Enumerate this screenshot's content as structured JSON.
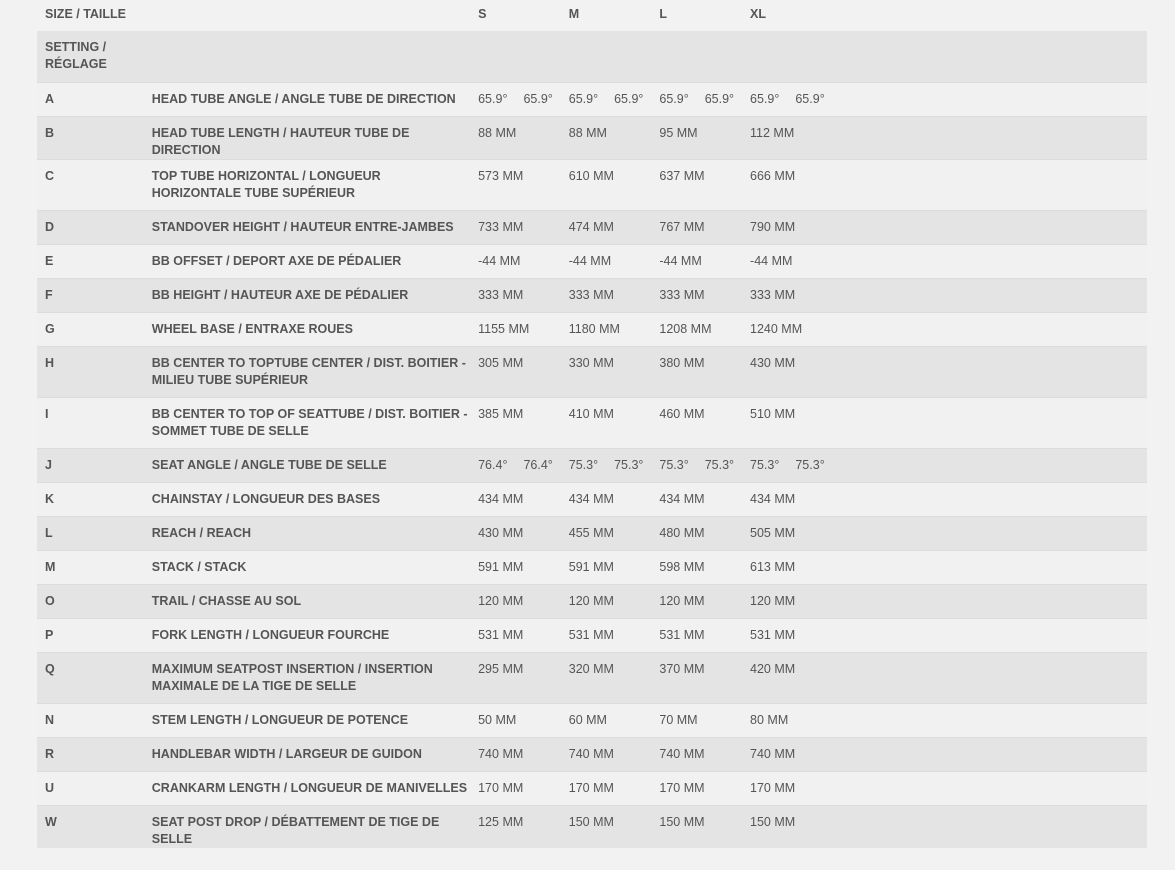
{
  "header": {
    "size_label": "SIZE / TAILLE",
    "sizes": [
      "S",
      "M",
      "L",
      "XL"
    ]
  },
  "setting_label": "SETTING /\nRÉGLAGE",
  "rows": [
    {
      "code": "A",
      "name": "HEAD TUBE ANGLE / ANGLE TUBE DE DIRECTION",
      "values": [
        "65.9°",
        "65.9°",
        "65.9°",
        "65.9°"
      ],
      "alt_values": [
        "65.9°",
        "65.9°",
        "65.9°",
        "65.9°"
      ]
    },
    {
      "code": "B",
      "name": "HEAD TUBE LENGTH / HAUTEUR TUBE DE DIRECTION",
      "values": [
        "88 MM",
        "88 MM",
        "95 MM",
        "112 MM"
      ]
    },
    {
      "code": "C",
      "name": "TOP TUBE HORIZONTAL / LONGUEUR HORIZONTALE TUBE SUPÉRIEUR",
      "values": [
        "573 MM",
        "610 MM",
        "637 MM",
        "666 MM"
      ]
    },
    {
      "code": "D",
      "name": "STANDOVER HEIGHT / HAUTEUR ENTRE-JAMBES",
      "values": [
        "733 MM",
        "474 MM",
        "767 MM",
        "790 MM"
      ]
    },
    {
      "code": "E",
      "name": "BB OFFSET / DEPORT AXE DE PÉDALIER",
      "values": [
        "-44 MM",
        "-44 MM",
        "-44 MM",
        "-44 MM"
      ]
    },
    {
      "code": "F",
      "name": "BB HEIGHT / HAUTEUR AXE DE PÉDALIER",
      "values": [
        "333 MM",
        "333 MM",
        "333 MM",
        "333 MM"
      ]
    },
    {
      "code": "G",
      "name": "WHEEL BASE / ENTRAXE ROUES",
      "values": [
        "1155 MM",
        "1180 MM",
        "1208 MM",
        "1240 MM"
      ]
    },
    {
      "code": "H",
      "name": "BB CENTER TO TOPTUBE CENTER / DIST. BOITIER - MILIEU TUBE SUPÉRIEUR",
      "values": [
        "305 MM",
        "330 MM",
        "380 MM",
        "430 MM"
      ]
    },
    {
      "code": "I",
      "name": "BB CENTER TO TOP OF SEATTUBE / DIST. BOITIER - SOMMET TUBE DE SELLE",
      "values": [
        "385 MM",
        "410 MM",
        "460 MM",
        "510 MM"
      ]
    },
    {
      "code": "J",
      "name": "SEAT ANGLE / ANGLE TUBE DE SELLE",
      "values": [
        "76.4°",
        "75.3°",
        "75.3°",
        "75.3°"
      ],
      "alt_values": [
        "76.4°",
        "75.3°",
        "75.3°",
        "75.3°"
      ]
    },
    {
      "code": "K",
      "name": "CHAINSTAY / LONGUEUR DES BASES",
      "values": [
        "434 MM",
        "434 MM",
        "434 MM",
        "434 MM"
      ]
    },
    {
      "code": "L",
      "name": "REACH / REACH",
      "values": [
        "430 MM",
        "455 MM",
        "480 MM",
        "505 MM"
      ]
    },
    {
      "code": "M",
      "name": "STACK / STACK",
      "values": [
        "591 MM",
        "591 MM",
        "598 MM",
        "613 MM"
      ]
    },
    {
      "code": "O",
      "name": "TRAIL / CHASSE AU SOL",
      "values": [
        "120 MM",
        "120 MM",
        "120 MM",
        "120 MM"
      ]
    },
    {
      "code": "P",
      "name": "FORK LENGTH / LONGUEUR FOURCHE",
      "values": [
        "531 MM",
        "531 MM",
        "531 MM",
        "531 MM"
      ]
    },
    {
      "code": "Q",
      "name": "MAXIMUM SEATPOST INSERTION / INSERTION MAXIMALE DE LA TIGE DE SELLE",
      "values": [
        "295 MM",
        "320 MM",
        "370 MM",
        "420 MM"
      ]
    },
    {
      "code": "N",
      "name": "STEM LENGTH / LONGUEUR DE POTENCE",
      "values": [
        "50 MM",
        "60 MM",
        "70 MM",
        "80 MM"
      ]
    },
    {
      "code": "R",
      "name": "HANDLEBAR WIDTH / LARGEUR DE GUIDON",
      "values": [
        "740 MM",
        "740 MM",
        "740 MM",
        "740 MM"
      ]
    },
    {
      "code": "U",
      "name": "CRANKARM LENGTH / LONGUEUR DE MANIVELLES",
      "values": [
        "170 MM",
        "170 MM",
        "170 MM",
        "170 MM"
      ]
    },
    {
      "code": "W",
      "name": "SEAT POST DROP / DÉBATTEMENT DE TIGE DE SELLE",
      "values": [
        "125 MM",
        "150 MM",
        "150 MM",
        "150 MM"
      ]
    }
  ]
}
